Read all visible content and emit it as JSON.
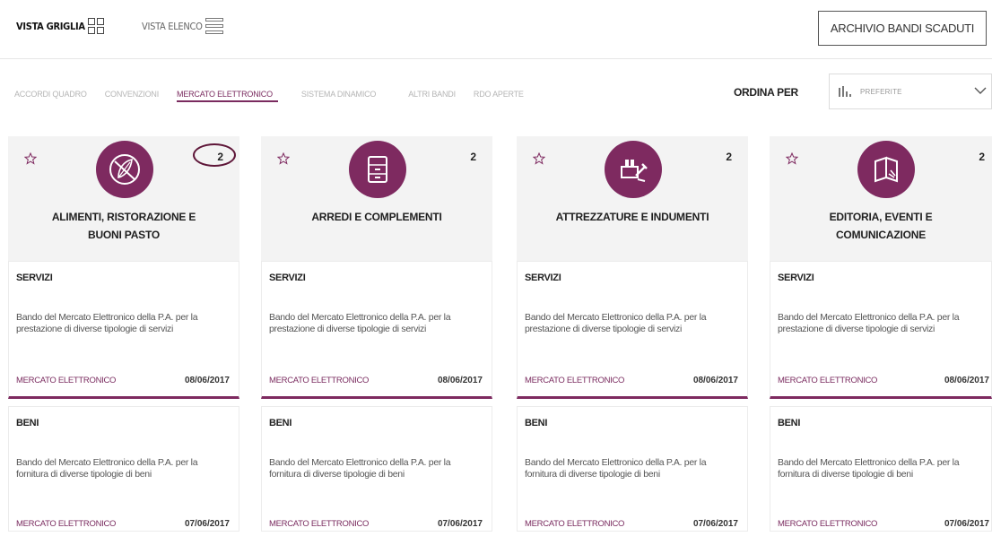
{
  "toolbar": {
    "grid_view_label": "VISTA GRIGLIA",
    "list_view_label": "VISTA ELENCO",
    "archive_button_label": "ARCHIVIO BANDI SCADUTI"
  },
  "filters": [
    {
      "label": "ACCORDI QUADRO",
      "active": false
    },
    {
      "label": "CONVENZIONI",
      "active": false
    },
    {
      "label": "MERCATO ELETTRONICO",
      "active": true
    },
    {
      "label": "SISTEMA DINAMICO",
      "active": false
    },
    {
      "label": "ALTRI BANDI",
      "active": false
    },
    {
      "label": "RDO APERTE",
      "active": false
    }
  ],
  "sort": {
    "label": "ORDINA PER",
    "selected": "PREFERITE"
  },
  "accent_color": "#7e2a60",
  "cards": [
    {
      "icon": "wheat-leaf-icon",
      "count": "2",
      "title_line1": "ALIMENTI, RISTORAZIONE E",
      "title_line2": "BUONI PASTO",
      "items": [
        {
          "type": "SERVIZI",
          "desc": "Bando del Mercato Elettronico della P.A. per la prestazione di diverse tipologie di servizi",
          "category": "MERCATO ELETTRONICO",
          "date": "08/06/2017"
        },
        {
          "type": "BENI",
          "desc": "Bando del Mercato Elettronico della P.A. per la fornitura di diverse tipologie di beni",
          "category": "MERCATO ELETTRONICO",
          "date": "07/06/2017"
        }
      ]
    },
    {
      "icon": "cabinet-icon",
      "count": "2",
      "title_line1": "ARREDI E COMPLEMENTI",
      "title_line2": "",
      "items": [
        {
          "type": "SERVIZI",
          "desc": "Bando del Mercato Elettronico della P.A. per la prestazione di diverse tipologie di servizi",
          "category": "MERCATO ELETTRONICO",
          "date": "08/06/2017"
        },
        {
          "type": "BENI",
          "desc": "Bando del Mercato Elettronico della P.A. per la fornitura di diverse tipologie di beni",
          "category": "MERCATO ELETTRONICO",
          "date": "07/06/2017"
        }
      ]
    },
    {
      "icon": "tools-icon",
      "count": "2",
      "title_line1": "ATTREZZATURE E INDUMENTI",
      "title_line2": "",
      "items": [
        {
          "type": "SERVIZI",
          "desc": "Bando del Mercato Elettronico della P.A. per la prestazione di diverse tipologie di servizi",
          "category": "MERCATO ELETTRONICO",
          "date": "08/06/2017"
        },
        {
          "type": "BENI",
          "desc": "Bando del Mercato Elettronico della P.A. per la fornitura di diverse tipologie di beni",
          "category": "MERCATO ELETTRONICO",
          "date": "07/06/2017"
        }
      ]
    },
    {
      "icon": "book-icon",
      "count": "2",
      "title_line1": "EDITORIA, EVENTI E",
      "title_line2": "COMUNICAZIONE",
      "items": [
        {
          "type": "SERVIZI",
          "desc": "Bando del Mercato Elettronico della P.A. per la prestazione di diverse tipologie di servizi",
          "category": "MERCATO ELETTRONICO",
          "date": "08/06/2017"
        },
        {
          "type": "BENI",
          "desc": "Bando del Mercato Elettronico della P.A. per la fornitura di diverse tipologie di beni",
          "category": "MERCATO ELETTRONICO",
          "date": "07/06/2017"
        }
      ]
    }
  ]
}
